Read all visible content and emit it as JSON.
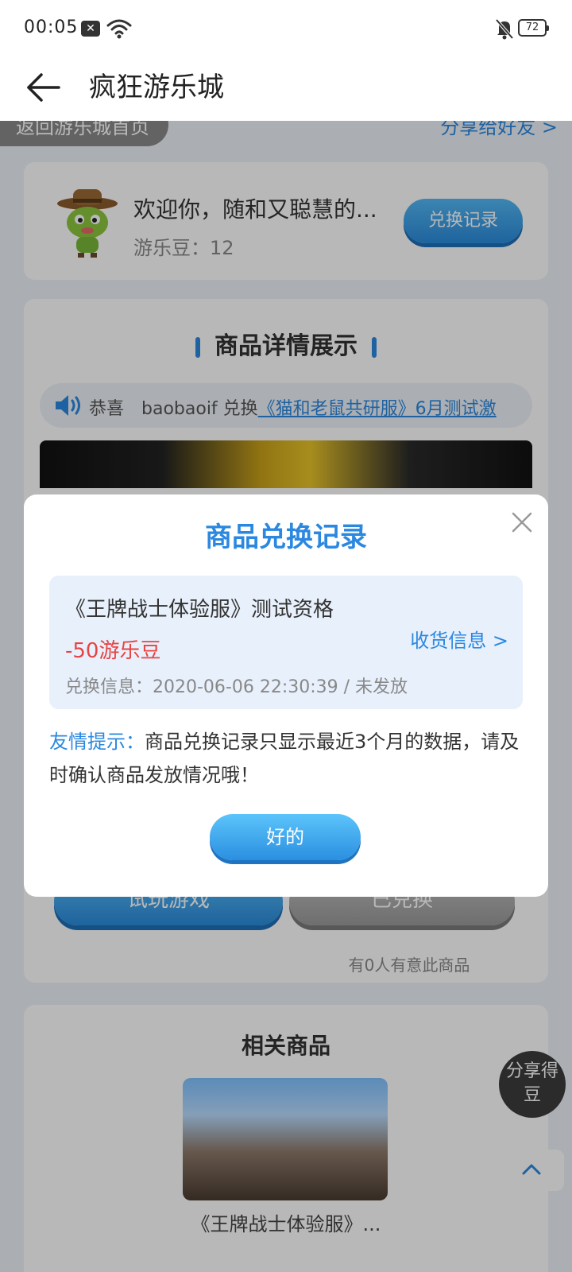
{
  "status_bar": {
    "time": "00:05",
    "battery": "72"
  },
  "header": {
    "title": "疯狂游乐城"
  },
  "page": {
    "return_label": "返回游乐城首页",
    "share_friends": "分享给好友 >",
    "user": {
      "welcome": "欢迎你，随和又聪慧的...",
      "beans": "游乐豆：12",
      "record_button": "兑换记录"
    },
    "detail": {
      "section_title": "商品详情展示",
      "ticker_prefix": "恭喜　baobaoif 兑换",
      "ticker_link": "《猫和老鼠共研服》6月测试激",
      "try_button": "试玩游戏",
      "redeemed_button": "已兑换",
      "interest_text": "有0人有意此商品"
    },
    "related": {
      "title": "相关商品",
      "item_name": "《王牌战士体验服》..."
    },
    "float_share": "分享得豆"
  },
  "modal": {
    "title": "商品兑换记录",
    "record": {
      "name": "《王牌战士体验服》测试资格",
      "cost": "-50游乐豆",
      "info": "兑换信息：2020-06-06 22:30:39 / 未发放",
      "shipping_link": "收货信息 >"
    },
    "tip_label": "友情提示：",
    "tip_text": "商品兑换记录只显示最近3个月的数据，请及时确认商品发放情况哦！",
    "ok_button": "好的"
  },
  "colors": {
    "accent": "#2b88e0",
    "danger": "#e84343"
  }
}
